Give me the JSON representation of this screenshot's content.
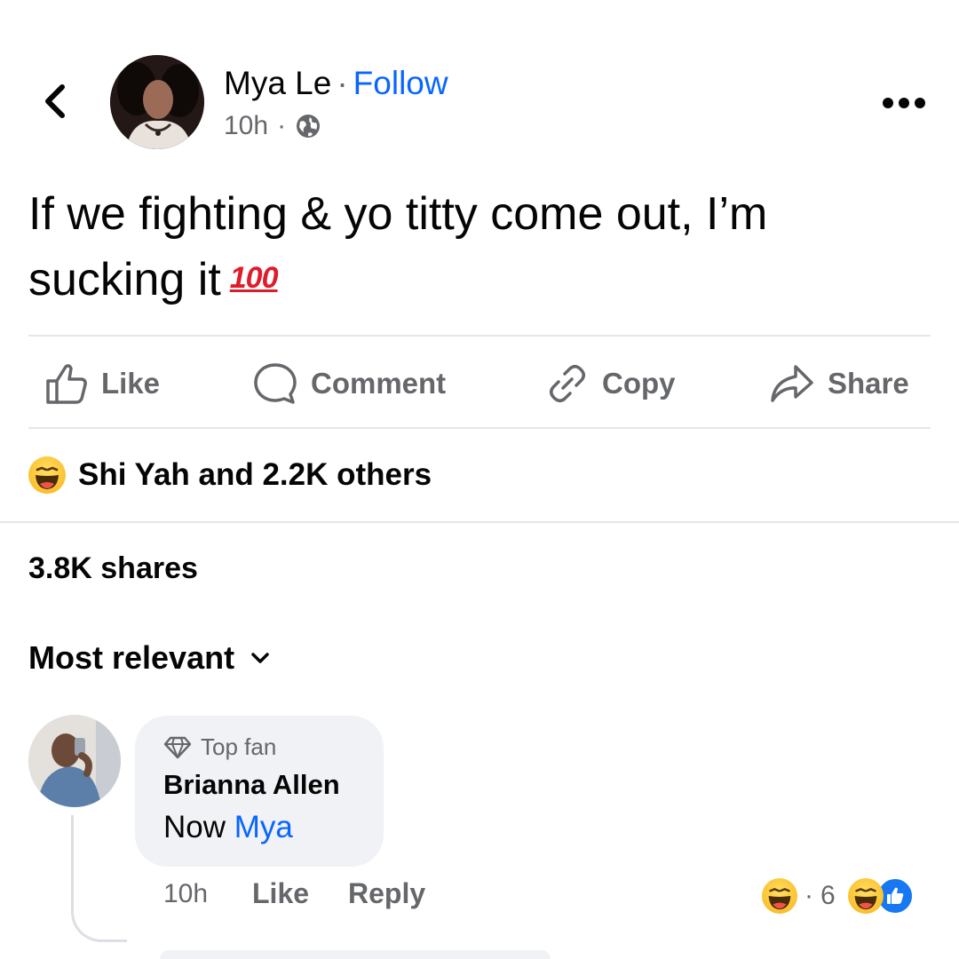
{
  "header": {
    "back_icon": "chevron-left-icon",
    "author_name": "Mya Le",
    "separator": "·",
    "follow_label": "Follow",
    "time": "10h",
    "meta_separator": "·",
    "audience_icon": "globe-icon",
    "more_icon": "more-horizontal-icon"
  },
  "post": {
    "text": "If we fighting & yo titty come out, I’m sucking it",
    "emoji": "100"
  },
  "actions": {
    "like": "Like",
    "comment": "Comment",
    "copy": "Copy",
    "share": "Share"
  },
  "reactions": {
    "reaction_icon": "haha-emoji-icon",
    "summary": "Shi Yah and 2.2K others"
  },
  "shares": {
    "label": "3.8K shares"
  },
  "sort": {
    "label": "Most relevant"
  },
  "comment": {
    "badge_icon": "diamond-icon",
    "badge": "Top fan",
    "author": "Brianna Allen",
    "text_prefix": "Now",
    "mention": "Mya",
    "time": "10h",
    "like_label": "Like",
    "reply_label": "Reply",
    "reaction_separator": "·",
    "reaction_count": "6"
  },
  "colors": {
    "link_blue": "#0866ff",
    "secondary_text": "#65676b",
    "bubble": "#f0f2f5",
    "divider": "#e4e6eb",
    "like_badge": "#1877f2",
    "emoji_100_red": "#dd1d2c"
  }
}
